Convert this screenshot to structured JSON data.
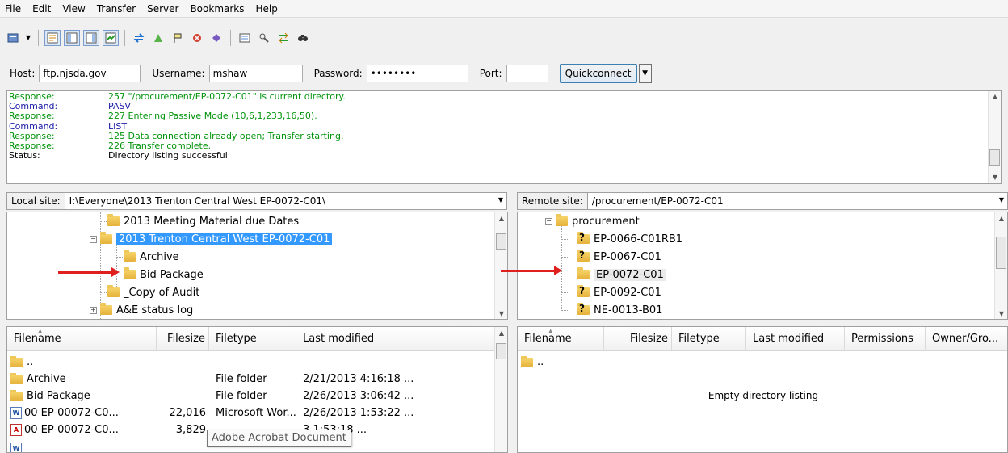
{
  "menu": [
    "File",
    "Edit",
    "View",
    "Transfer",
    "Server",
    "Bookmarks",
    "Help"
  ],
  "toolbar_icons": [
    "site-manager-icon",
    "dropdown-arrow-icon",
    "toggle-log-icon",
    "toggle-local-tree-icon",
    "toggle-remote-tree-icon",
    "toggle-queue-icon",
    "refresh-icon",
    "process-queue-icon",
    "cancel-icon",
    "disconnect-icon",
    "reconnect-icon",
    "filter-icon",
    "compare-icon",
    "sync-browse-icon",
    "search-icon"
  ],
  "quickconnect": {
    "host_label": "Host:",
    "host_value": "ftp.njsda.gov",
    "username_label": "Username:",
    "username_value": "mshaw",
    "password_label": "Password:",
    "password_value": "••••••••",
    "port_label": "Port:",
    "port_value": "",
    "button": "Quickconnect"
  },
  "log": [
    {
      "type": "Response:",
      "text": "257 \"/procurement/EP-0072-C01\" is current directory.",
      "kind": "resp"
    },
    {
      "type": "Command:",
      "text": "PASV",
      "kind": "cmd"
    },
    {
      "type": "Response:",
      "text": "227 Entering Passive Mode (10,6,1,233,16,50).",
      "kind": "resp"
    },
    {
      "type": "Command:",
      "text": "LIST",
      "kind": "cmd"
    },
    {
      "type": "Response:",
      "text": "125 Data connection already open; Transfer starting.",
      "kind": "resp"
    },
    {
      "type": "Response:",
      "text": "226 Transfer complete.",
      "kind": "resp"
    },
    {
      "type": "Status:",
      "text": "Directory listing successful",
      "kind": "stat"
    }
  ],
  "local": {
    "label": "Local site:",
    "path": "I:\\Everyone\\2013 Trenton Central West EP-0072-C01\\",
    "tree": [
      "2013 Meeting Material due Dates",
      "2013 Trenton Central West EP-0072-C01",
      "Archive",
      "Bid Package",
      "_Copy of Audit",
      "A&E status log"
    ],
    "columns": [
      "Filename",
      "Filesize",
      "Filetype",
      "Last modified"
    ],
    "files": [
      {
        "name": "..",
        "size": "",
        "type": "",
        "modified": ""
      },
      {
        "name": "Archive",
        "size": "",
        "type": "File folder",
        "modified": "2/21/2013 4:16:18 ..."
      },
      {
        "name": "Bid Package",
        "size": "",
        "type": "File folder",
        "modified": "2/26/2013 3:06:42 ..."
      },
      {
        "name": "00 EP-00072-C0...",
        "size": "22,016",
        "type": "Microsoft Wor...",
        "modified": "2/26/2013 1:53:22 ..."
      },
      {
        "name": "00 EP-00072-C0...",
        "size": "3,829",
        "type": "",
        "modified": "3 1:53:18 ..."
      }
    ],
    "tooltip": "Adobe Acrobat Document"
  },
  "remote": {
    "label": "Remote site:",
    "path": "/procurement/EP-0072-C01",
    "tree": [
      "procurement",
      "EP-0066-C01RB1",
      "EP-0067-C01",
      "EP-0072-C01",
      "EP-0092-C01",
      "NE-0013-B01"
    ],
    "columns": [
      "Filename",
      "Filesize",
      "Filetype",
      "Last modified",
      "Permissions",
      "Owner/Gro..."
    ],
    "files": [
      {
        "name": ".."
      }
    ],
    "empty": "Empty directory listing"
  }
}
